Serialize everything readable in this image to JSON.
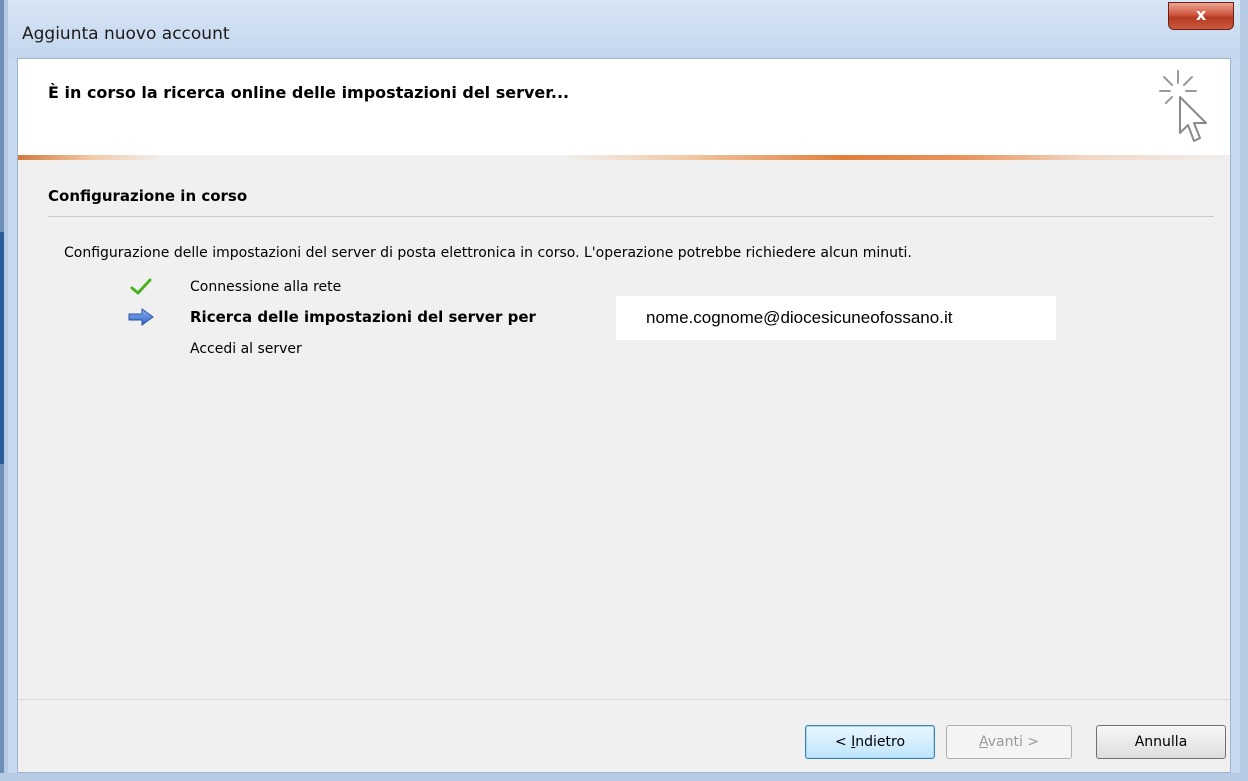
{
  "window": {
    "title": "Aggiunta nuovo account",
    "close_glyph": "x"
  },
  "header": {
    "title": "È in corso la ricerca online delle impostazioni del server...",
    "icon": "sparkle-cursor-icon"
  },
  "section": {
    "title": "Configurazione in corso"
  },
  "description": "Configurazione delle impostazioni del server di posta elettronica in corso. L'operazione potrebbe richiedere alcun minuti.",
  "steps": [
    {
      "label": "Connessione alla rete",
      "status": "done",
      "icon": "checkmark-icon"
    },
    {
      "label": "Ricerca delle impostazioni del server per",
      "status": "in-progress",
      "icon": "arrow-right-icon"
    },
    {
      "label": "Accedi al server",
      "status": "pending",
      "icon": ""
    }
  ],
  "email": "nome.cognome@diocesicuneofossano.it",
  "buttons": {
    "back": {
      "prefix": "< ",
      "accel": "I",
      "rest": "ndietro"
    },
    "next": {
      "accel": "A",
      "rest": "vanti >"
    },
    "cancel": "Annulla"
  },
  "colors": {
    "check": "#4caf22",
    "arrow": "#3a6fd0",
    "close": "#c9472f"
  }
}
